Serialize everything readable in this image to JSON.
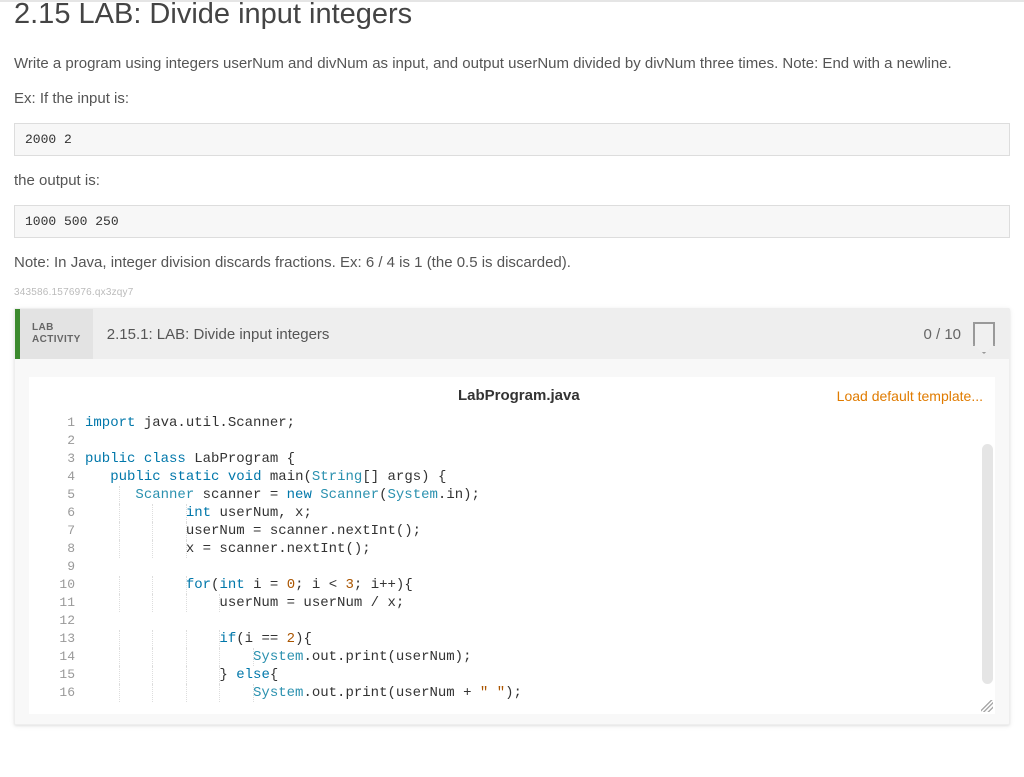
{
  "page": {
    "title": "2.15 LAB: Divide input integers",
    "p1": "Write a program using integers userNum and divNum as input, and output userNum divided by divNum three times. Note: End with a newline.",
    "p2": "Ex: If the input is:",
    "code1": "2000 2",
    "p3": "the output is:",
    "code2": "1000 500 250",
    "p4": "Note: In Java, integer division discards fractions. Ex: 6 / 4 is 1 (the 0.5 is discarded).",
    "small_id": "343586.1576976.qx3zqy7"
  },
  "activity": {
    "tag_line1": "LAB",
    "tag_line2": "ACTIVITY",
    "title": "2.15.1: LAB: Divide input integers",
    "score": "0 / 10",
    "filename": "LabProgram.java",
    "load_label": "Load default template..."
  },
  "code": {
    "lines": [
      [
        [
          "kw",
          "import"
        ],
        [
          "",
          " java.util.Scanner;"
        ]
      ],
      [
        [
          "",
          ""
        ]
      ],
      [
        [
          "kw",
          "public"
        ],
        [
          "",
          " "
        ],
        [
          "kw",
          "class"
        ],
        [
          "",
          " LabProgram {"
        ]
      ],
      [
        [
          "",
          "   "
        ],
        [
          "kw",
          "public"
        ],
        [
          "",
          " "
        ],
        [
          "kw",
          "static"
        ],
        [
          "",
          " "
        ],
        [
          "kw",
          "void"
        ],
        [
          "",
          " main("
        ],
        [
          "type",
          "String"
        ],
        [
          "",
          "[] args) {"
        ]
      ],
      [
        [
          "",
          "      "
        ],
        [
          "type",
          "Scanner"
        ],
        [
          "",
          " scanner = "
        ],
        [
          "kw",
          "new"
        ],
        [
          "",
          " "
        ],
        [
          "type",
          "Scanner"
        ],
        [
          "",
          "("
        ],
        [
          "type",
          "System"
        ],
        [
          "",
          ".in);"
        ]
      ],
      [
        [
          "",
          "            "
        ],
        [
          "kw",
          "int"
        ],
        [
          "",
          " userNum, x;"
        ]
      ],
      [
        [
          "",
          "            userNum = scanner.nextInt();"
        ]
      ],
      [
        [
          "",
          "            x = scanner.nextInt();"
        ]
      ],
      [
        [
          "",
          ""
        ]
      ],
      [
        [
          "",
          "            "
        ],
        [
          "kw",
          "for"
        ],
        [
          "",
          "("
        ],
        [
          "kw",
          "int"
        ],
        [
          "",
          " i = "
        ],
        [
          "num",
          "0"
        ],
        [
          "",
          "; i < "
        ],
        [
          "num",
          "3"
        ],
        [
          "",
          "; i++){"
        ]
      ],
      [
        [
          "",
          "                userNum = userNum / x;"
        ]
      ],
      [
        [
          "",
          ""
        ]
      ],
      [
        [
          "",
          "                "
        ],
        [
          "kw",
          "if"
        ],
        [
          "",
          "(i == "
        ],
        [
          "num",
          "2"
        ],
        [
          "",
          "){"
        ]
      ],
      [
        [
          "",
          "                    "
        ],
        [
          "type",
          "System"
        ],
        [
          "",
          ".out.print(userNum);"
        ]
      ],
      [
        [
          "",
          "                } "
        ],
        [
          "kw",
          "else"
        ],
        [
          "",
          "{"
        ]
      ],
      [
        [
          "",
          "                    "
        ],
        [
          "type",
          "System"
        ],
        [
          "",
          ".out.print(userNum + "
        ],
        [
          "str",
          "\" \""
        ],
        [
          "",
          ");"
        ]
      ]
    ]
  }
}
